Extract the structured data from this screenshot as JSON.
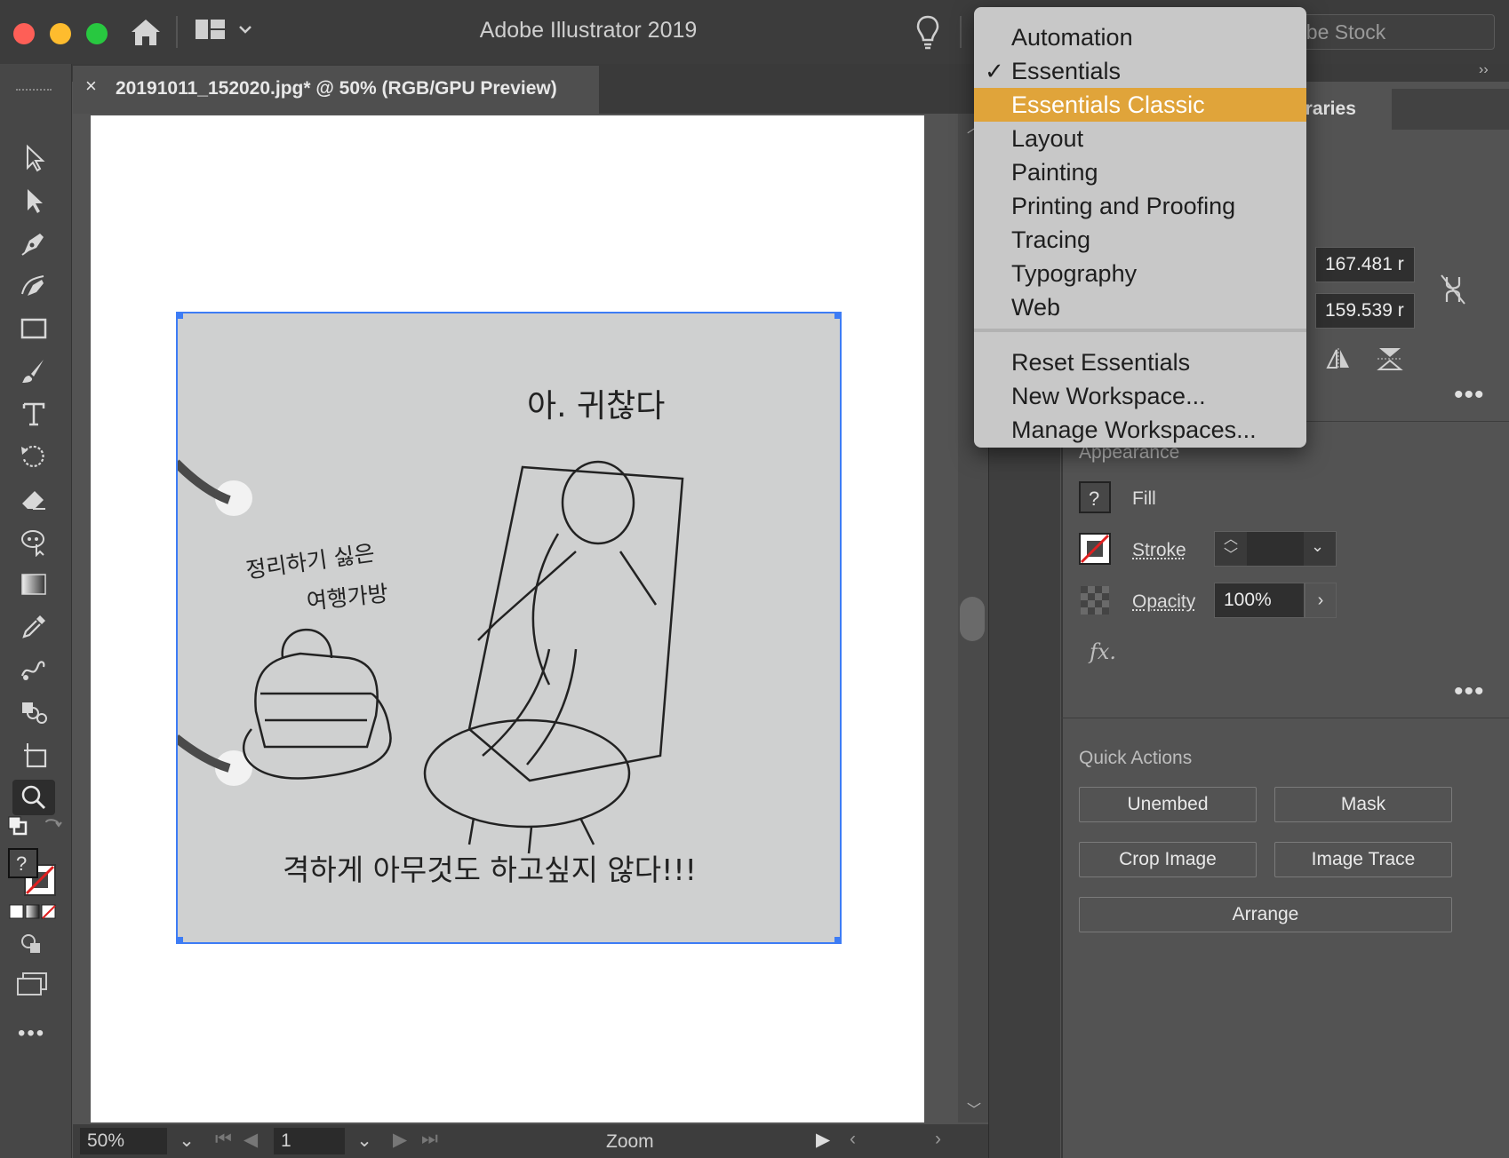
{
  "app": {
    "title": "Adobe Illustrator 2019"
  },
  "search": {
    "text": "obe Stock"
  },
  "document_tab": {
    "close_glyph": "×",
    "title": "20191011_152020.jpg* @ 50% (RGB/GPU Preview)"
  },
  "workspace_menu": {
    "items": [
      {
        "label": "Automation",
        "checked": false,
        "highlighted": false
      },
      {
        "label": "Essentials",
        "checked": true,
        "highlighted": false
      },
      {
        "label": "Essentials Classic",
        "checked": false,
        "highlighted": true
      },
      {
        "label": "Layout",
        "checked": false,
        "highlighted": false
      },
      {
        "label": "Painting",
        "checked": false,
        "highlighted": false
      },
      {
        "label": "Printing and Proofing",
        "checked": false,
        "highlighted": false
      },
      {
        "label": "Tracing",
        "checked": false,
        "highlighted": false
      },
      {
        "label": "Typography",
        "checked": false,
        "highlighted": false
      },
      {
        "label": "Web",
        "checked": false,
        "highlighted": false
      }
    ],
    "actions": [
      "Reset Essentials",
      "New Workspace...",
      "Manage Workspaces..."
    ],
    "check_glyph": "✓"
  },
  "panel": {
    "libraries_tab": "ibraries",
    "width_value": "167.481 r",
    "height_value": "159.539 r",
    "appearance": {
      "heading": "Appearance",
      "fill_label": "Fill",
      "stroke_label": "Stroke",
      "opacity_label": "Opacity",
      "opacity_value": "100%",
      "fx_label": "fx."
    },
    "quick_actions": {
      "heading": "Quick Actions",
      "unembed": "Unembed",
      "mask": "Mask",
      "crop_image": "Crop Image",
      "image_trace": "Image Trace",
      "arrange": "Arrange"
    },
    "more_glyph": "•••"
  },
  "status": {
    "zoom": "50%",
    "artboard": "1",
    "tool_name": "Zoom"
  },
  "drawing": {
    "text_top": "아. 귀찮다",
    "text_left1": "정리하기 싫은",
    "text_left2": "여행가방",
    "text_bottom": "격하게 아무것도 하고싶지 않다!!!"
  },
  "colors": {
    "highlight": "#e0a43a",
    "selection": "#3d7cf5",
    "close": "#fe5f57",
    "minimize": "#febc2e",
    "maximize": "#28c840"
  }
}
